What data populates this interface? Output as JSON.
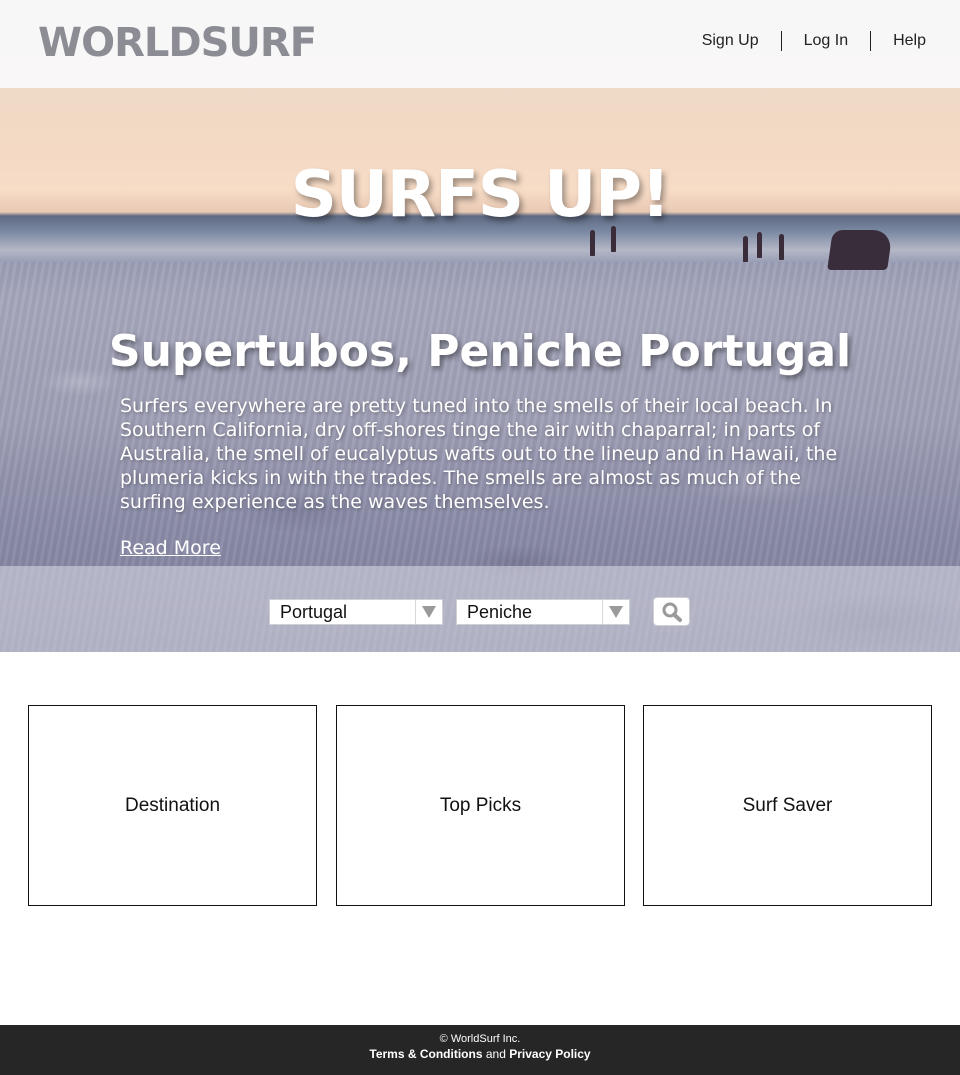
{
  "brand": {
    "logo_text": "WORLDSURF"
  },
  "nav": {
    "sign_up": "Sign Up",
    "log_in": "Log In",
    "help": "Help"
  },
  "hero": {
    "headline": "SURFS UP!",
    "place_title": "Supertubos, Peniche Portugal",
    "description": "Surfers everywhere are pretty tuned into the smells of their local beach. In Southern California, dry off-shores tinge the air with chaparral; in parts of Australia, the smell of eucalyptus wafts out to the lineup and in Hawaii, the plumeria kicks in with the trades. The smells are almost as much of the surfing experience as the waves themselves.",
    "read_more": "Read More"
  },
  "search": {
    "country": "Portugal",
    "town": "Peniche",
    "dropdown_icon": "triangle-down-icon",
    "button_icon": "magnifier-icon"
  },
  "cards": [
    {
      "label": "Destination"
    },
    {
      "label": "Top Picks"
    },
    {
      "label": "Surf Saver"
    }
  ],
  "footer": {
    "copyright": "© WorldSurf Inc.",
    "terms": "Terms & Conditions",
    "and": "and",
    "privacy": "Privacy Policy"
  },
  "colors": {
    "footer_bg": "#262626",
    "logo_gray": "#8c8c94",
    "hero_text": "#ffffff"
  }
}
